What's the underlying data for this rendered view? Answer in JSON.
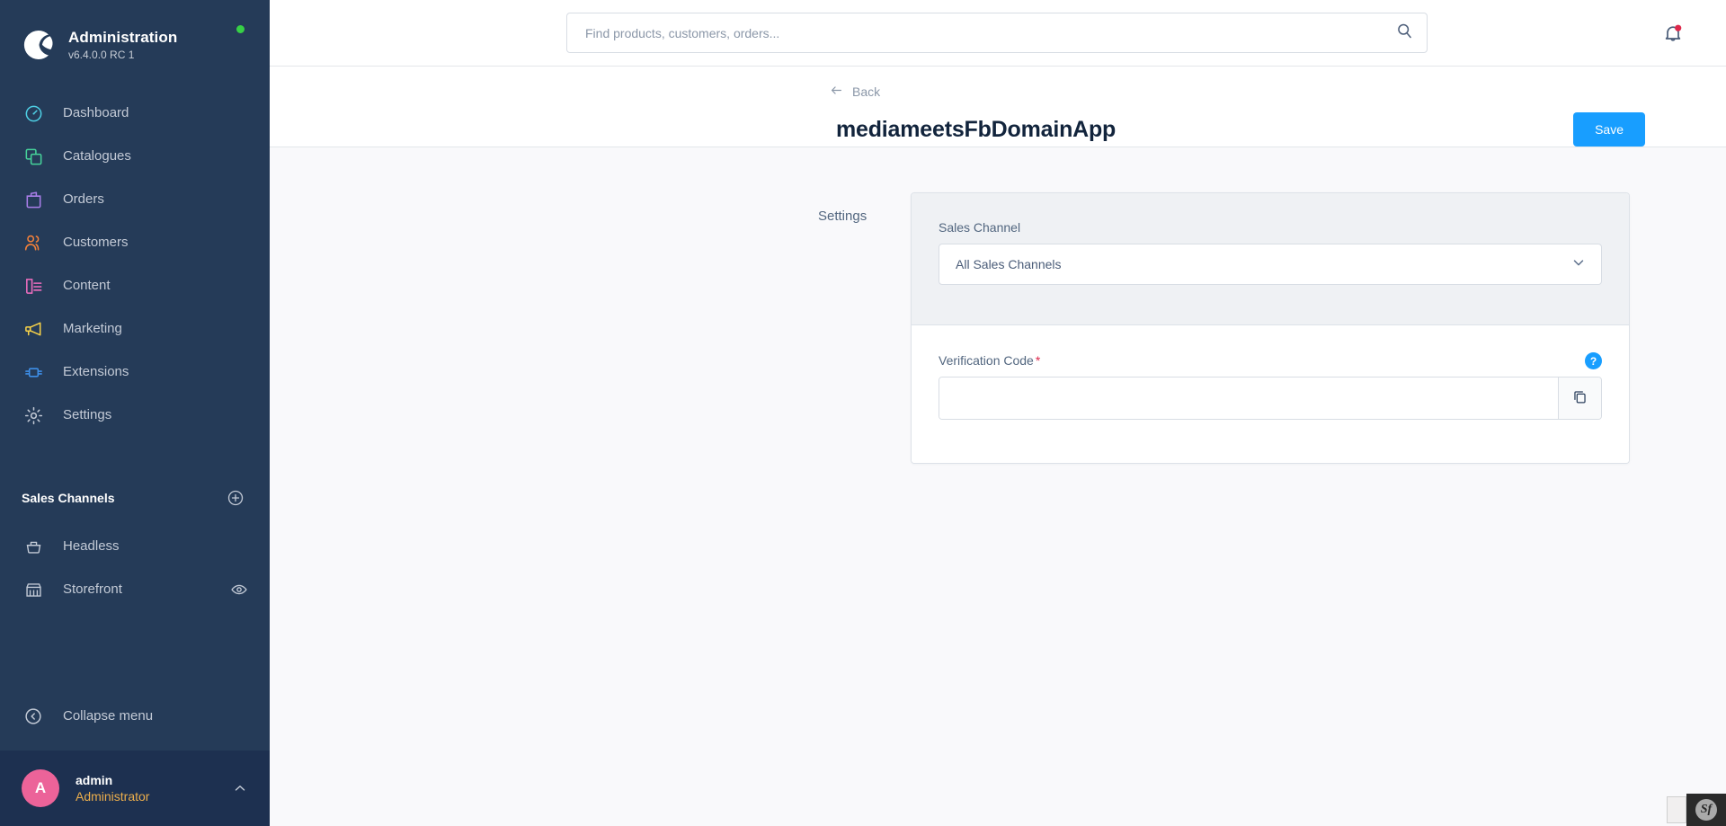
{
  "sidebar": {
    "brand": {
      "title": "Administration",
      "version": "v6.4.0.0 RC 1",
      "status_dot_color": "#37d046",
      "logo_icon": "shopware-logo-icon"
    },
    "nav": [
      {
        "label": "Dashboard",
        "icon": "gauge-icon",
        "color": "#4ecfe4"
      },
      {
        "label": "Catalogues",
        "icon": "copy-icon",
        "color": "#46d29a"
      },
      {
        "label": "Orders",
        "icon": "bag-icon",
        "color": "#a97ee8"
      },
      {
        "label": "Customers",
        "icon": "users-icon",
        "color": "#f4813a"
      },
      {
        "label": "Content",
        "icon": "content-icon",
        "color": "#f06ec0"
      },
      {
        "label": "Marketing",
        "icon": "megaphone-icon",
        "color": "#f7d148"
      },
      {
        "label": "Extensions",
        "icon": "plugin-icon",
        "color": "#3e8fe8"
      },
      {
        "label": "Settings",
        "icon": "gear-icon",
        "color": "#c3cad6"
      }
    ],
    "sales_channels": {
      "title": "Sales Channels",
      "add_icon": "plus-circle-icon",
      "items": [
        {
          "label": "Headless",
          "icon": "basket-icon",
          "trailing_icon": ""
        },
        {
          "label": "Storefront",
          "icon": "storefront-icon",
          "trailing_icon": "eye-icon"
        }
      ]
    },
    "collapse": {
      "label": "Collapse menu",
      "icon": "collapse-icon"
    },
    "user": {
      "avatar_initial": "A",
      "avatar_color": "#ec6399",
      "name": "admin",
      "role": "Administrator",
      "role_color": "#ecae4c",
      "chevron_icon": "chevron-up-icon"
    }
  },
  "topbar": {
    "search": {
      "placeholder": "Find products, customers, orders...",
      "value": "",
      "icon": "search-icon"
    },
    "notifications": {
      "icon": "bell-icon",
      "has_unread": true,
      "dot_color": "#de294c"
    }
  },
  "page_header": {
    "back": {
      "label": "Back",
      "icon": "arrow-left-icon"
    },
    "title": "mediameetsFbDomainApp",
    "save_label": "Save",
    "save_color": "#189eff"
  },
  "content": {
    "section_label": "Settings",
    "sales_channel": {
      "label": "Sales Channel",
      "selected": "All Sales Channels",
      "chevron_icon": "chevron-down-icon"
    },
    "verification_code": {
      "label": "Verification Code",
      "required_marker": "*",
      "value": "",
      "placeholder": "",
      "help_icon": "help-icon",
      "help_glyph": "?",
      "copy_icon": "copy-icon"
    }
  },
  "debug_toolbar": {
    "icon": "symfony-icon",
    "glyph": "Sf"
  }
}
